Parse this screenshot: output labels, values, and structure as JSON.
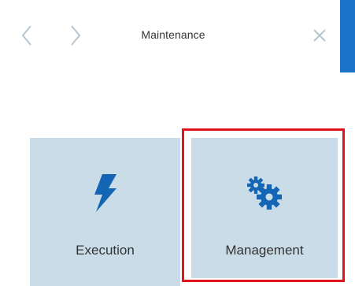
{
  "header": {
    "title": "Maintenance",
    "back_icon": "chevron-left-icon",
    "forward_icon": "chevron-right-icon",
    "close_icon": "close-icon"
  },
  "tiles": [
    {
      "label": "Execution",
      "icon": "lightning-icon"
    },
    {
      "label": "Management",
      "icon": "gears-icon"
    }
  ],
  "colors": {
    "accent": "#1a73c7",
    "tile_bg": "#c9dce8",
    "icon": "#1565b5",
    "highlight": "#e0141a",
    "nav_icon": "#b8c6d0"
  }
}
